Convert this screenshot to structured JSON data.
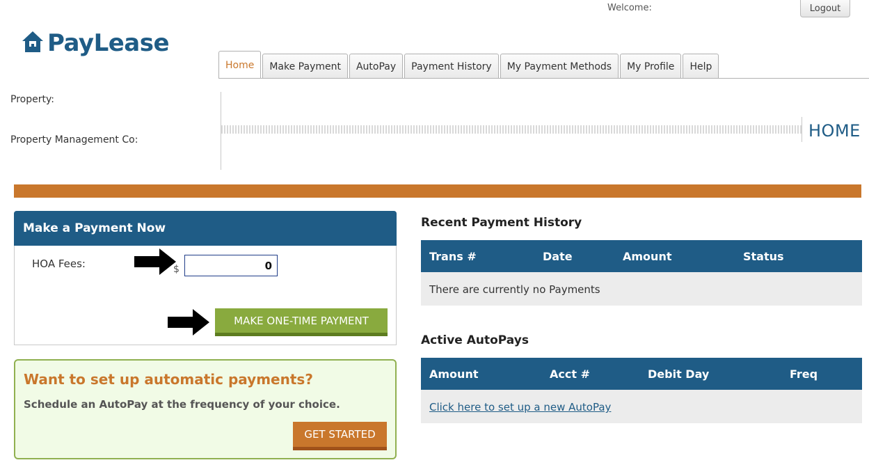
{
  "header": {
    "welcome_label": "Welcome:",
    "logout_label": "Logout",
    "logo_text": "PayLease"
  },
  "tabs": [
    {
      "label": "Home",
      "active": true
    },
    {
      "label": "Make Payment"
    },
    {
      "label": "AutoPay"
    },
    {
      "label": "Payment History"
    },
    {
      "label": "My Payment Methods"
    },
    {
      "label": "My Profile"
    },
    {
      "label": "Help"
    }
  ],
  "property": {
    "property_label": "Property:",
    "management_label": "Property Management Co:",
    "page_title": "HOME"
  },
  "make_payment": {
    "heading": "Make a Payment Now",
    "fee_label": "HOA Fees:",
    "currency_symbol": "$",
    "amount_value": "0",
    "button_label": "MAKE ONE-TIME PAYMENT"
  },
  "autopay_promo": {
    "title": "Want to set up automatic payments?",
    "text": "Schedule an AutoPay at the frequency of your choice.",
    "button_label": "GET STARTED"
  },
  "recent_history": {
    "title": "Recent Payment History",
    "columns": [
      "Trans #",
      "Date",
      "Amount",
      "Status"
    ],
    "empty_message": "There are currently no Payments"
  },
  "active_autopays": {
    "title": "Active AutoPays",
    "columns": [
      "Amount",
      "Acct #",
      "Debit Day",
      "Freq"
    ],
    "setup_link": "Click here to set up a new AutoPay"
  },
  "colors": {
    "brand_blue": "#1f5c86",
    "accent_orange": "#c9772c",
    "button_green": "#89aa3e"
  }
}
